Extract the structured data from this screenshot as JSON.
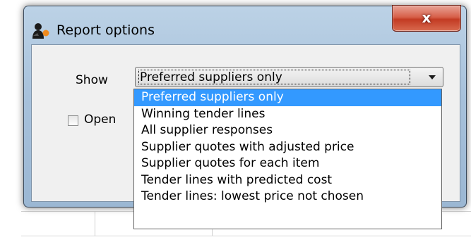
{
  "window": {
    "title": "Report options",
    "close_label": "x"
  },
  "form": {
    "show_label": "Show",
    "show_value": "Preferred suppliers only",
    "open_label": "Open",
    "open_checked": false
  },
  "dropdown": {
    "items": [
      "Preferred suppliers only",
      "Winning tender lines",
      "All supplier responses",
      "Supplier quotes with adjusted price",
      "Supplier quotes for each item",
      "Tender lines with predicted cost",
      "Tender lines: lowest price not chosen"
    ],
    "selected_index": 0
  },
  "colors": {
    "selection_highlight": "#3399ff",
    "close_button": "#c33b23"
  },
  "icons": {
    "app": "report-person-icon",
    "close": "close-icon",
    "combo": "chevron-down-icon"
  }
}
